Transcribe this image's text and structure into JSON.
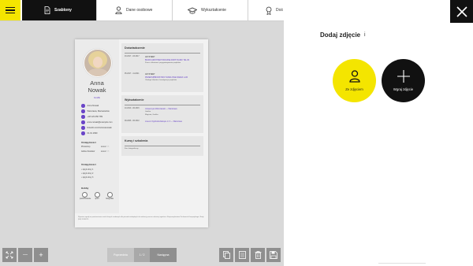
{
  "topbar": {
    "tabs": [
      {
        "label": "Szablony",
        "icon": "document-icon",
        "active": true
      },
      {
        "label": "Dane osobowe",
        "icon": "user-icon",
        "active": false
      },
      {
        "label": "Wykształcenie",
        "icon": "graduation-cap-icon",
        "active": false
      },
      {
        "label": "Doś",
        "icon": "badge-icon",
        "active": false
      }
    ]
  },
  "cv": {
    "first_name": "Anna",
    "last_name": "Nowak",
    "role": "Grafik",
    "contacts": [
      "Anna Nowak",
      "Warszawa, Mazowieckie",
      "+48 123 456 789",
      "anna.nowak@example.com",
      "linkedin.com/in/annanowak",
      "01.01.1990"
    ],
    "skills_title": "Umiejętności",
    "skills": [
      "Photoshop",
      "Adobe Illustrator"
    ],
    "languages_title": "Umiejętności",
    "languages": [
      "Język obcy 1",
      "Język obcy 2",
      "Język obcy 3"
    ],
    "hobby_title": "Hobby",
    "hobbies": [
      "podróżowanie",
      "sport",
      "fotografia"
    ],
    "experience_title": "Doświadczenie",
    "experience": [
      {
        "dates": "03.2017 - 03.2017",
        "role": "ASYSTENT",
        "company": "BIURO ARCHITEKTONICZNE PARTYZANKI TELUS",
        "desc": "Praca z klientami i przygotowywanie projektów"
      },
      {
        "dates": "05.2017 - 11.2021",
        "role": "ASYSTENT",
        "company": "PRZEDSIĘBIORSTWO HANDLOWE RADEK LAM",
        "desc": "Obsługa klientów i koordynacja projektów"
      }
    ],
    "education_title": "Wykształcenie",
    "education": [
      {
        "dates": "10.2010 - 06.2015",
        "school": "Uniwersytet Warszawski — Warszawa",
        "field": "Grafika",
        "degree": "Magister, Grafika"
      },
      {
        "dates": "09.2006 - 06.2010",
        "school": "Liceum Ogólnokształcące nr 3 — Warszawa",
        "field": "",
        "degree": ""
      }
    ],
    "courses_title": "Kursy i szkolenia",
    "courses_item": "Kurs fotograficzny",
    "footer": "Wyrażam zgodę na przetwarzanie moich danych osobowych dla potrzeb niezbędnych do realizacji procesu rekrutacji zgodnie z Rozporządzeniem Parlamentu Europejskiego i Rady (UE) 2016/679."
  },
  "toolbar": {
    "fit_icon": "fit-screen-icon",
    "zoom_out": "—",
    "zoom_in": "+",
    "prev_label": "Poprzednia",
    "page_indicator": "1 / 2",
    "next_label": "Następna",
    "actions": [
      "duplicate-icon",
      "list-icon",
      "delete-icon",
      "save-icon"
    ]
  },
  "panel": {
    "title": "Dodaj zdjęcie",
    "info_glyph": "i",
    "options": [
      {
        "label": "Ze zdjęciem",
        "icon": "user-icon",
        "color": "#f4e500"
      },
      {
        "label": "Wgraj zdjęcie",
        "icon": "plus-icon",
        "color": "#111111"
      }
    ]
  },
  "colors": {
    "accent": "#f4e500",
    "dark": "#111111",
    "purple": "#6a45c8"
  }
}
